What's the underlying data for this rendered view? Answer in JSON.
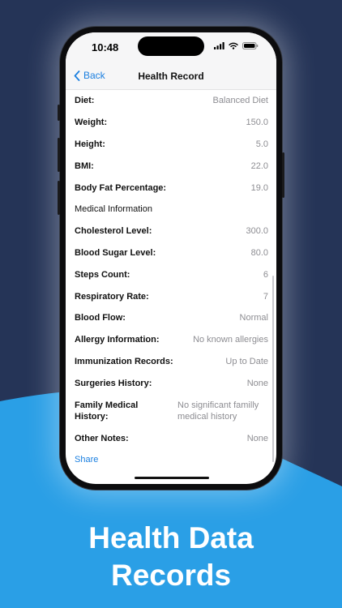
{
  "marketing": {
    "caption_line1": "Health Data",
    "caption_line2": "Records",
    "colors": {
      "background": "#253457",
      "wave": "#2a9fe6",
      "accent": "#1a7fe0"
    }
  },
  "status_bar": {
    "time": "10:48",
    "icons": [
      "cellular-signal-icon",
      "wifi-icon",
      "battery-icon"
    ]
  },
  "nav": {
    "back_label": "Back",
    "title": "Health Record"
  },
  "records": [
    {
      "label": "Diet:",
      "value": "Balanced Diet"
    },
    {
      "label": "Weight:",
      "value": "150.0"
    },
    {
      "label": "Height:",
      "value": "5.0"
    },
    {
      "label": "BMI:",
      "value": "22.0"
    },
    {
      "label": "Body Fat Percentage:",
      "value": "19.0"
    },
    {
      "label": "Medical Information",
      "value": ""
    },
    {
      "label": "Cholesterol Level:",
      "value": "300.0"
    },
    {
      "label": "Blood Sugar Level:",
      "value": "80.0"
    },
    {
      "label": "Steps Count:",
      "value": "6"
    },
    {
      "label": "Respiratory Rate:",
      "value": "7"
    },
    {
      "label": "Blood Flow:",
      "value": "Normal"
    },
    {
      "label": "Allergy Information:",
      "value": "No known allergies"
    },
    {
      "label": "Immunization Records:",
      "value": "Up to Date"
    },
    {
      "label": "Surgeries History:",
      "value": "None"
    },
    {
      "label": "Family Medical History:",
      "value": "No significant familly medical history"
    },
    {
      "label": "Other Notes:",
      "value": "None"
    }
  ],
  "share_label": "Share"
}
